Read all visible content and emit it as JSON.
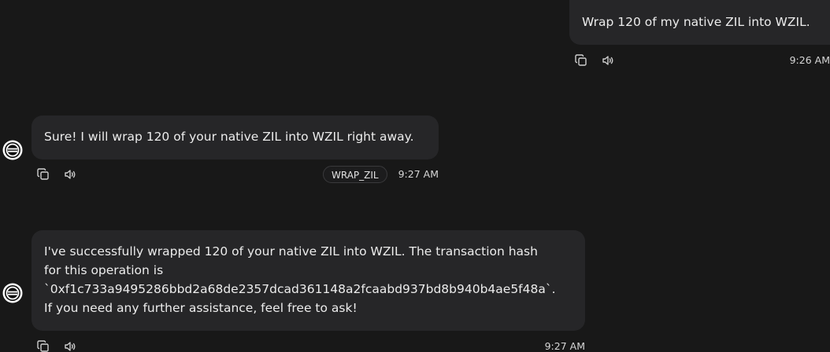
{
  "messages": [
    {
      "role": "user",
      "text": "Wrap 120 of my native ZIL into WZIL.",
      "time": "9:26 AM"
    },
    {
      "role": "assistant",
      "text": "Sure! I will wrap 120 of your native ZIL into WZIL right away.",
      "action_badge": "WRAP_ZIL",
      "time": "9:27 AM"
    },
    {
      "role": "assistant",
      "lines": [
        "I've successfully wrapped 120 of your native ZIL into WZIL. The transaction hash",
        "for this operation is",
        "`0xf1c733a9495286bbd2a68de2357dcad361148a2fcaabd937bd8b940b4ae5f48a`.",
        "If you need any further assistance, feel free to ask!"
      ],
      "time": "9:27 AM"
    }
  ],
  "icons": {
    "copy": "copy-icon",
    "speaker": "speaker-icon",
    "avatar": "assistant-logo-icon"
  }
}
